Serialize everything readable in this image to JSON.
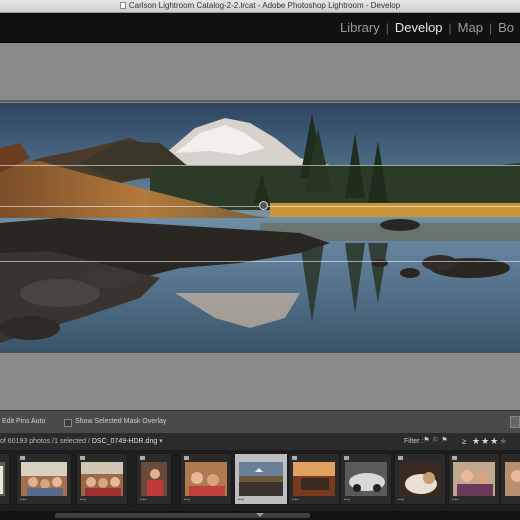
{
  "window": {
    "title": "Carlson Lightroom Catalog-2-2.lrcat - Adobe Photoshop Lightroom - Develop"
  },
  "modules": {
    "items": [
      "Library",
      "Develop",
      "Map",
      "Bo"
    ],
    "active": "Develop"
  },
  "toolbar": {
    "edit_pins_label": "Edit Pins :",
    "edit_pins_value": "Auto",
    "mask_overlay_label": "Show Selected Mask Overlay"
  },
  "filmstrip_header": {
    "count_text": "of 60193 photos /1 selected /",
    "filename": "DSC_0749-HDR.dng",
    "filter_label": "Filter :",
    "rating_operator": "≥",
    "rating_stars": 3
  },
  "thumbnails": [
    {
      "name": "thumb-partial-left",
      "kind": "green",
      "selected": false
    },
    {
      "name": "thumb-family-1",
      "kind": "family",
      "selected": false
    },
    {
      "name": "thumb-family-2",
      "kind": "family",
      "selected": false
    },
    {
      "name": "thumb-family-3",
      "kind": "family",
      "selected": false
    },
    {
      "name": "thumb-family-4",
      "kind": "family",
      "selected": false
    },
    {
      "name": "thumb-landscape-selected",
      "kind": "landscape",
      "selected": true
    },
    {
      "name": "thumb-room",
      "kind": "room",
      "selected": false
    },
    {
      "name": "thumb-car",
      "kind": "car",
      "selected": false
    },
    {
      "name": "thumb-dog",
      "kind": "dog",
      "selected": false
    },
    {
      "name": "thumb-family-5",
      "kind": "family",
      "selected": false
    },
    {
      "name": "thumb-partial-right",
      "kind": "family",
      "selected": false
    }
  ],
  "colors": {
    "active_module": "#e6e6e6",
    "inactive_module": "#9a9a9a",
    "work_area": "#898989"
  }
}
